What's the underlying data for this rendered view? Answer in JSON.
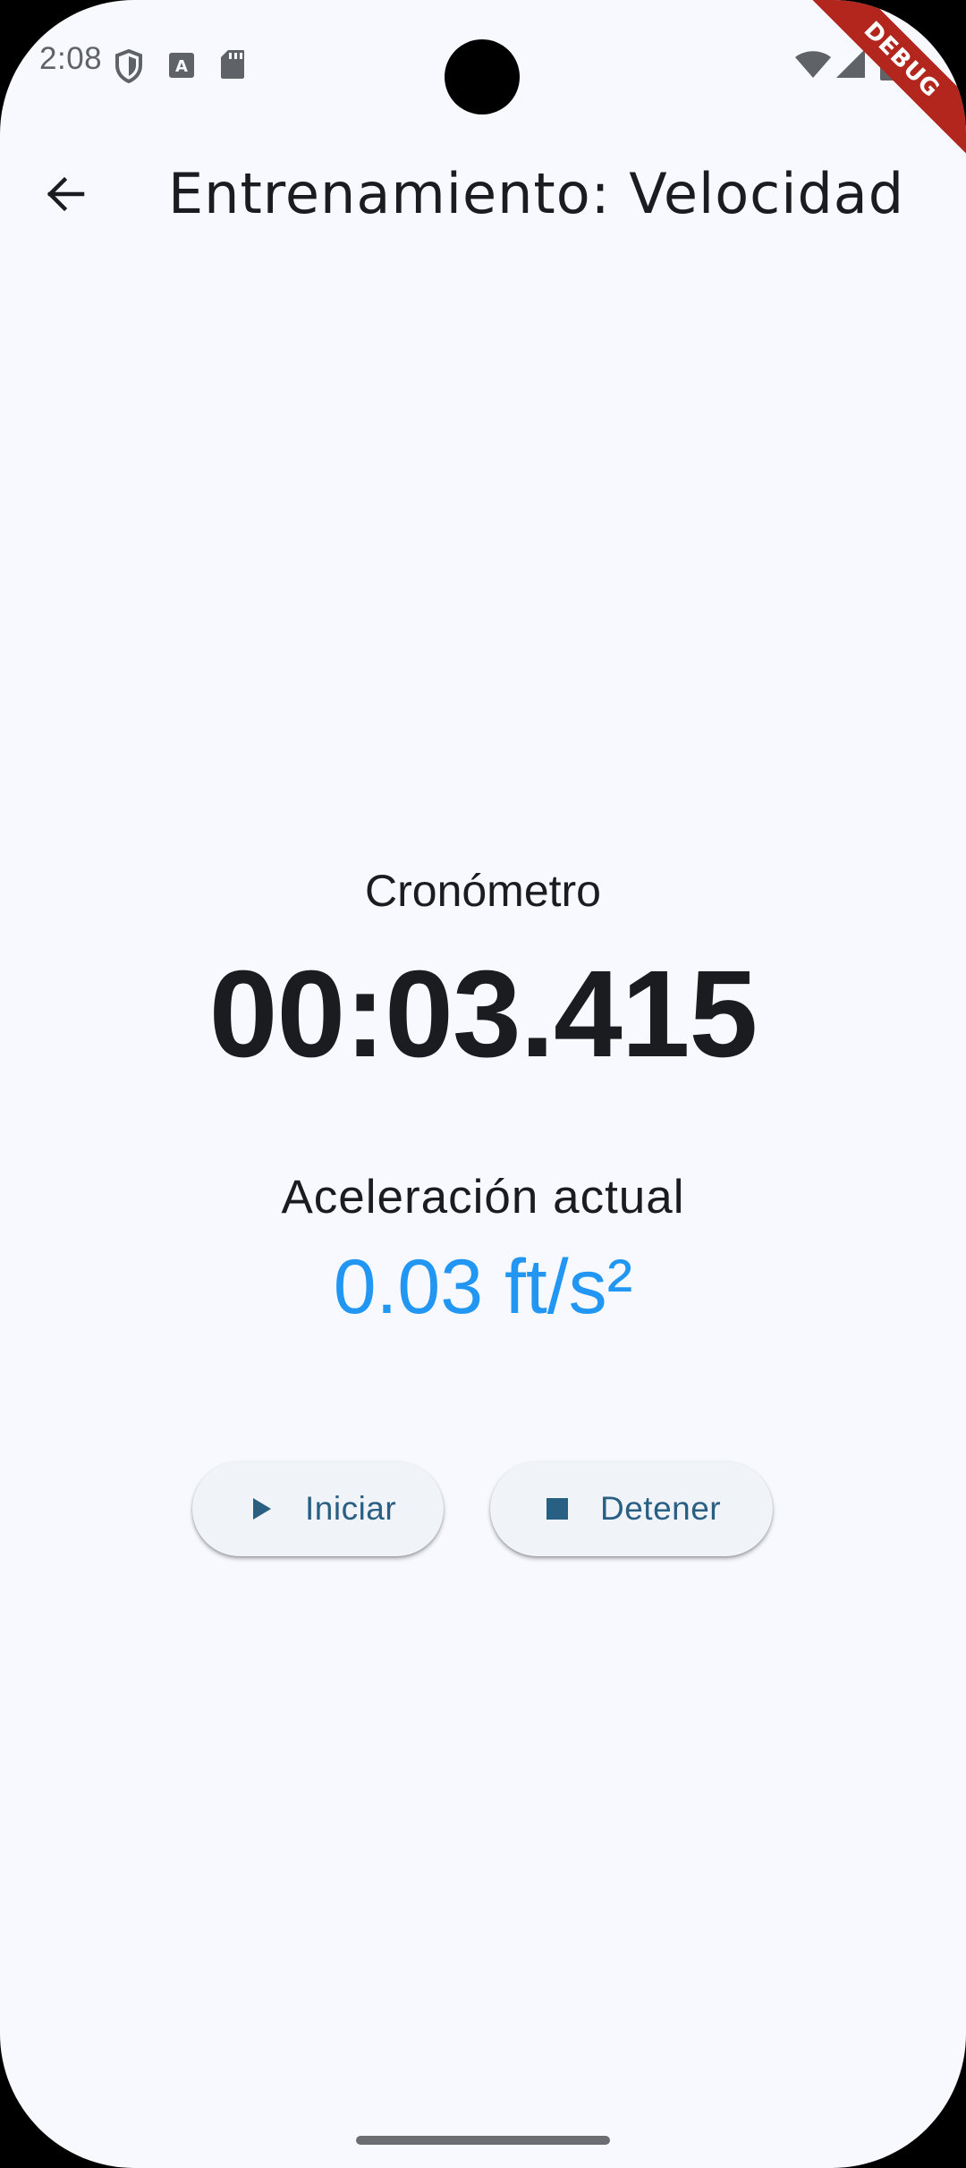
{
  "status_bar": {
    "time": "2:08",
    "icons": [
      "shield-icon",
      "font-download-icon",
      "sd-card-icon",
      "wifi-icon",
      "signal-icon",
      "battery-icon"
    ]
  },
  "debug_banner": "DEBUG",
  "app_bar": {
    "back_icon": "arrow-back-icon",
    "title": "Entrenamiento: Velocidad"
  },
  "stopwatch": {
    "label": "Cronómetro",
    "value": "00:03.415"
  },
  "acceleration": {
    "label": "Aceleración actual",
    "value": "0.03 ft/s²",
    "color": "#2196f3"
  },
  "buttons": {
    "start": {
      "label": "Iniciar",
      "icon": "play-icon"
    },
    "stop": {
      "label": "Detener",
      "icon": "stop-icon"
    }
  },
  "colors": {
    "background": "#f7f9fe",
    "button_text": "#2a5f84",
    "debug_banner": "#b3261e"
  }
}
